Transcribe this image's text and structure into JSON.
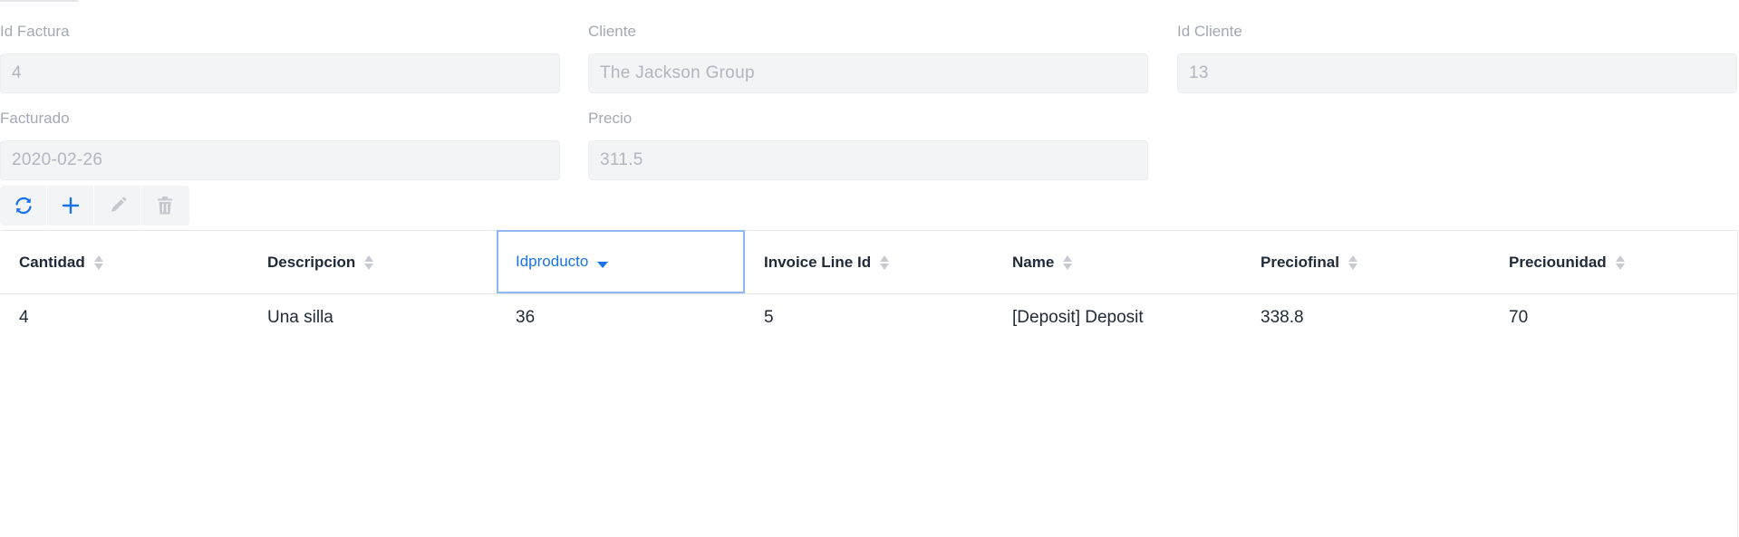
{
  "form": {
    "id_factura": {
      "label": "Id Factura",
      "value": "4"
    },
    "cliente": {
      "label": "Cliente",
      "value": "The Jackson Group"
    },
    "id_cliente": {
      "label": "Id Cliente",
      "value": "13"
    },
    "facturado": {
      "label": "Facturado",
      "value": "2020-02-26"
    },
    "precio": {
      "label": "Precio",
      "value": "311.5"
    }
  },
  "toolbar": {
    "buttons": [
      {
        "icon": "refresh-icon",
        "enabled": true
      },
      {
        "icon": "plus-icon",
        "enabled": true
      },
      {
        "icon": "pencil-icon",
        "enabled": false
      },
      {
        "icon": "trash-icon",
        "enabled": false
      }
    ],
    "colors": {
      "enabled": "#1a73e8",
      "disabled": "#b9bec6"
    }
  },
  "grid": {
    "columns": [
      {
        "label": "Cantidad"
      },
      {
        "label": "Descripcion"
      },
      {
        "label": "Idproducto",
        "sorted": "desc"
      },
      {
        "label": "Invoice Line Id"
      },
      {
        "label": "Name"
      },
      {
        "label": "Preciofinal"
      },
      {
        "label": "Preciounidad"
      }
    ],
    "rows": [
      [
        "4",
        "Una silla",
        "36",
        "5",
        "[Deposit] Deposit",
        "338.8",
        "70"
      ]
    ]
  }
}
